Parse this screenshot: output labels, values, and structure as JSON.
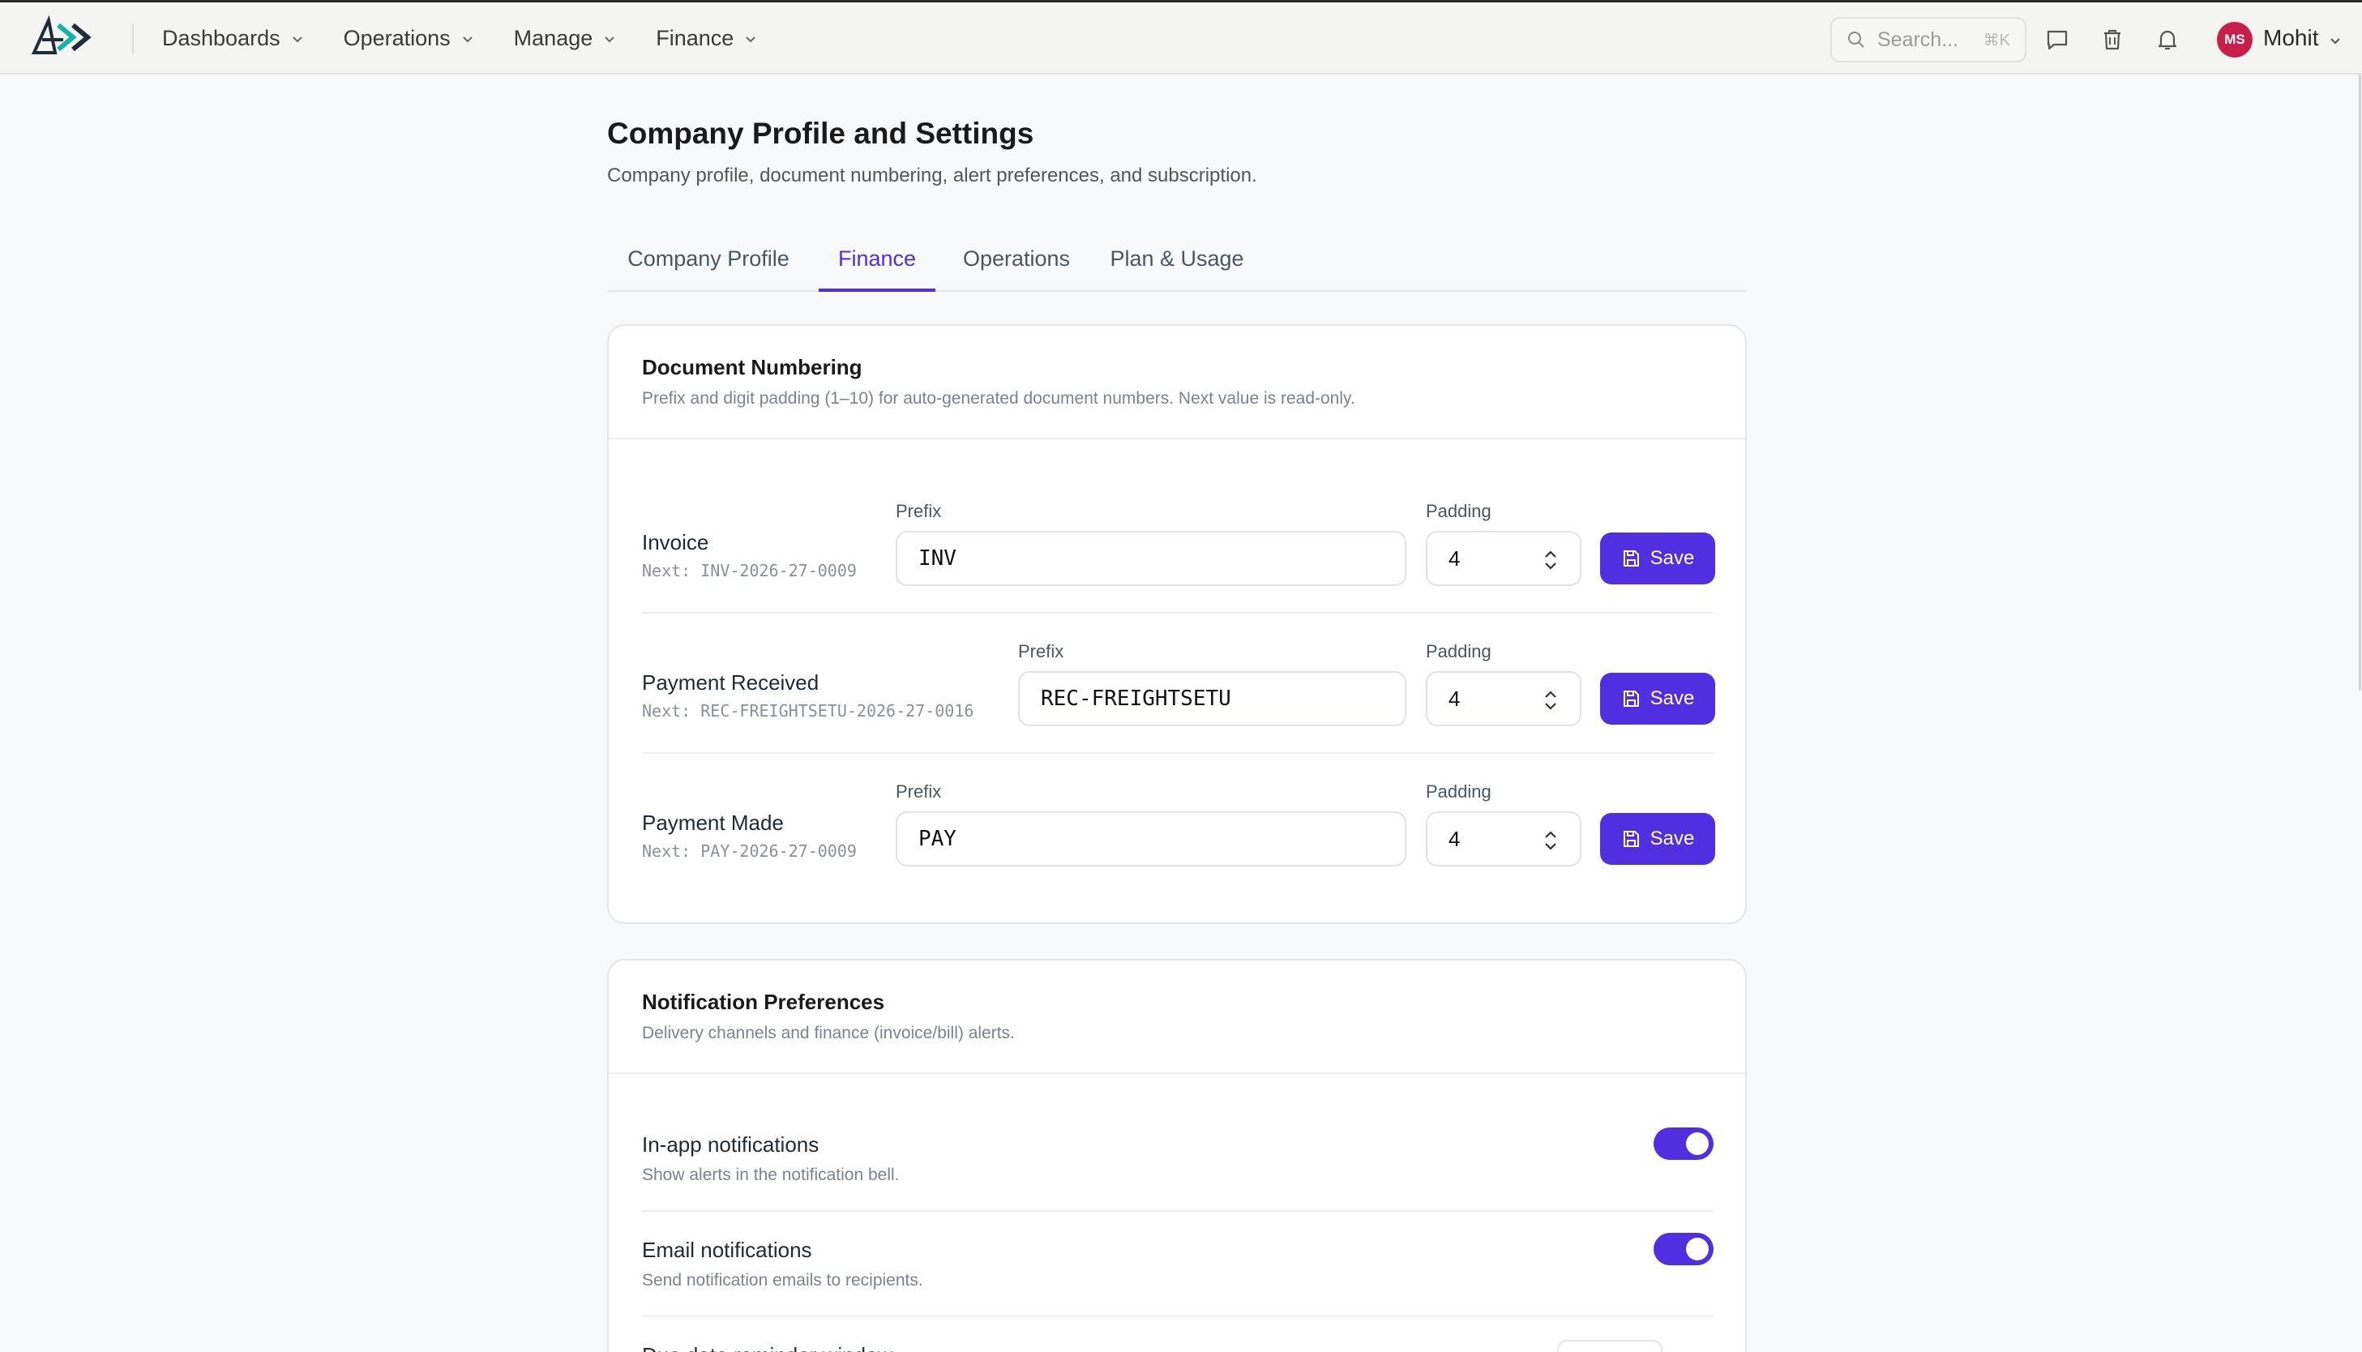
{
  "topbar": {
    "nav": [
      {
        "label": "Dashboards"
      },
      {
        "label": "Operations"
      },
      {
        "label": "Manage"
      },
      {
        "label": "Finance"
      }
    ],
    "search": {
      "placeholder": "Search...",
      "shortcut": "⌘K"
    },
    "icons": [
      "chat-icon",
      "trash-icon",
      "bell-icon"
    ],
    "user": {
      "initials": "MS",
      "name": "Mohit",
      "avatar_color": "#c81e4a"
    }
  },
  "page": {
    "title": "Company Profile and Settings",
    "subtitle": "Company profile, document numbering, alert preferences, and subscription."
  },
  "tabs": [
    {
      "label": "Company Profile",
      "active": false
    },
    {
      "label": "Finance",
      "active": true
    },
    {
      "label": "Operations",
      "active": false
    },
    {
      "label": "Plan & Usage",
      "active": false
    }
  ],
  "accent_color": "#4f2fe0",
  "numbering": {
    "title": "Document Numbering",
    "description": "Prefix and digit padding (1–10) for auto-generated document numbers. Next value is read-only.",
    "prefix_label": "Prefix",
    "padding_label": "Padding",
    "save_label": "Save",
    "rows": [
      {
        "label": "Invoice",
        "next": "Next: INV-2026-27-0009",
        "prefix": "INV",
        "padding": "4"
      },
      {
        "label": "Payment Received",
        "next": "Next: REC-FREIGHTSETU-2026-27-0016",
        "prefix": "REC-FREIGHTSETU",
        "padding": "4"
      },
      {
        "label": "Payment Made",
        "next": "Next: PAY-2026-27-0009",
        "prefix": "PAY",
        "padding": "4"
      }
    ]
  },
  "notifications": {
    "title": "Notification Preferences",
    "description": "Delivery channels and finance (invoice/bill) alerts.",
    "items": [
      {
        "title": "In-app notifications",
        "description": "Show alerts in the notification bell.",
        "enabled": true
      },
      {
        "title": "Email notifications",
        "description": "Send notification emails to recipients.",
        "enabled": true
      },
      {
        "title": "Due date reminder window",
        "description": "",
        "enabled": false
      }
    ]
  }
}
